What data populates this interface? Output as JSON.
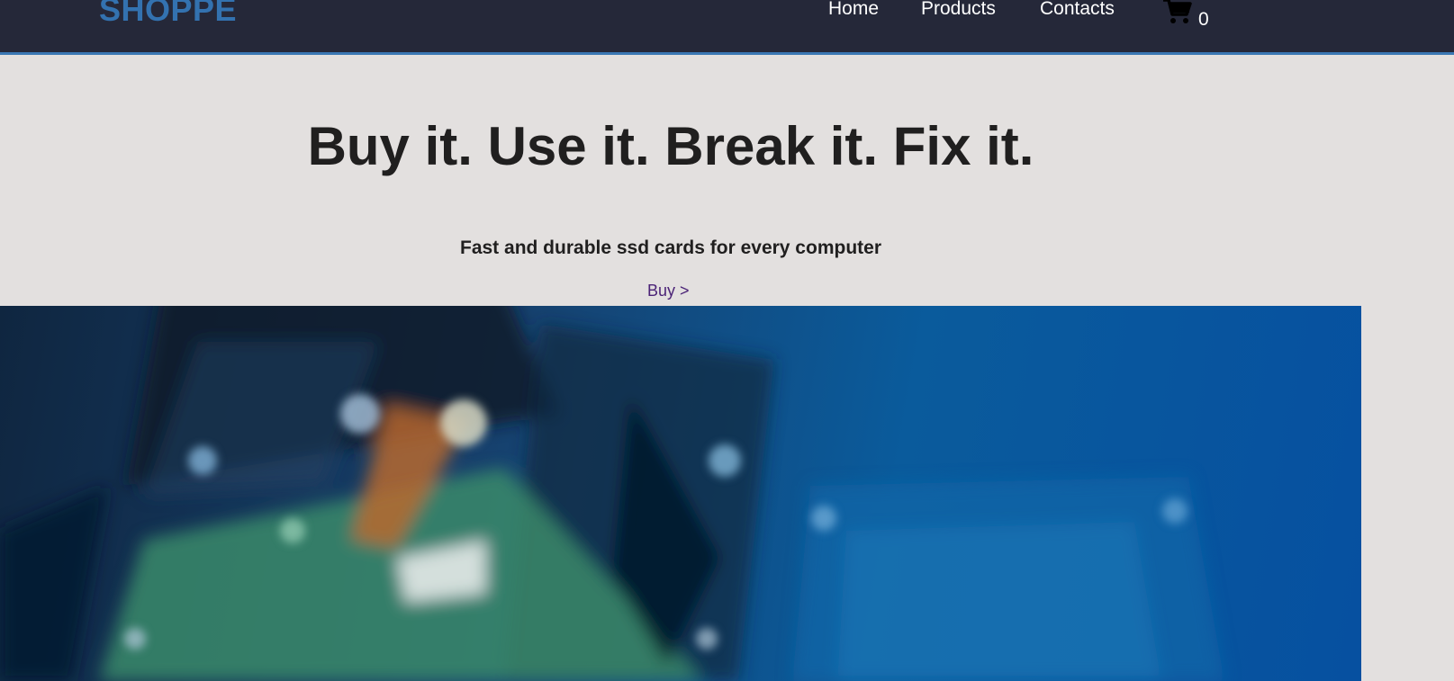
{
  "header": {
    "logo": "SHOPPE",
    "nav": {
      "home": "Home",
      "products": "Products",
      "contacts": "Contacts"
    },
    "cart": {
      "icon": "cart-icon",
      "count": "0"
    }
  },
  "hero": {
    "title": "Buy it. Use it. Break it. Fix it.",
    "subtitle": "Fast and durable ssd cards for every computer",
    "buy_label": "Buy >",
    "image": "ssd-photo"
  },
  "colors": {
    "navbar": "#252839",
    "accent": "#3372b0",
    "page_background": "#e3e0df",
    "link": "#4b2377"
  }
}
